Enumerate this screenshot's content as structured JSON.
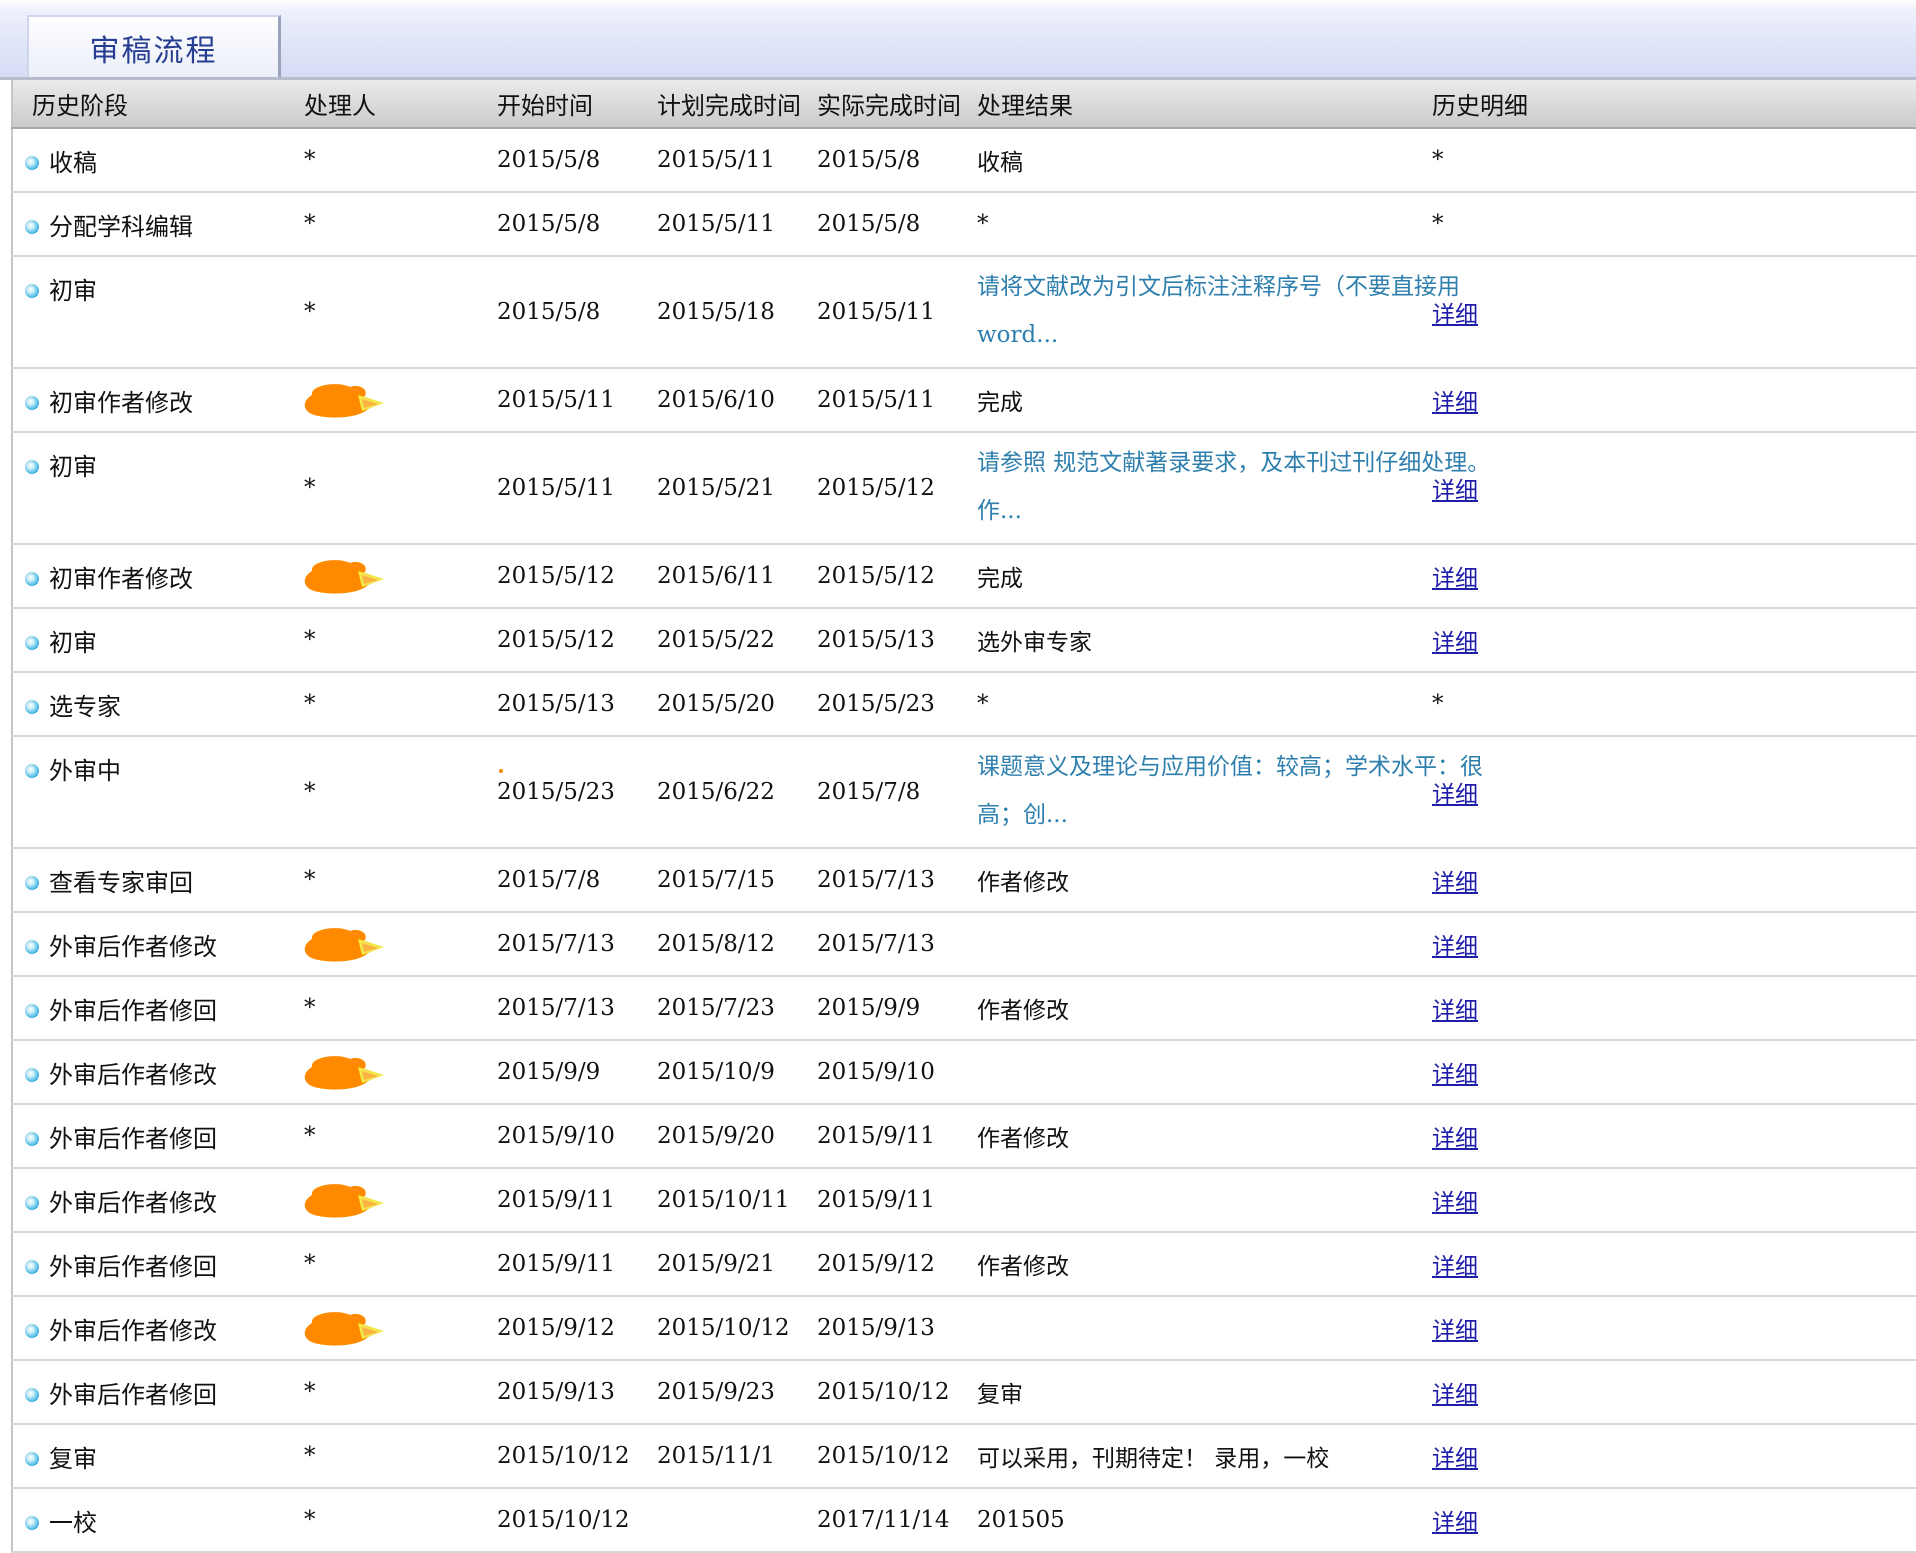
{
  "tab": {
    "title": "审稿流程"
  },
  "colors": {
    "tab_text": "#273e93",
    "link": "#1f1ea8",
    "result_note": "#2e7fae",
    "redaction": "#ff8a00"
  },
  "columns": [
    "历史阶段",
    "处理人",
    "开始时间",
    "计划完成时间",
    "实际完成时间",
    "处理结果",
    "历史明细"
  ],
  "rows": [
    {
      "stage": "收稿",
      "handler": "*",
      "start": "2015/5/8",
      "planned": "2015/5/11",
      "actual": "2015/5/8",
      "result": "收稿",
      "detail": "*"
    },
    {
      "stage": "分配学科编辑",
      "handler": "*",
      "start": "2015/5/8",
      "planned": "2015/5/11",
      "actual": "2015/5/8",
      "result": "*",
      "detail": "*"
    },
    {
      "stage": "初审",
      "handler": "*",
      "start": "2015/5/8",
      "planned": "2015/5/18",
      "actual": "2015/5/11",
      "result": "请将文献改为引文后标注注释序号（不要直接用word...",
      "detail": "详细"
    },
    {
      "stage": "初审作者修改",
      "handler": "",
      "start": "2015/5/11",
      "planned": "2015/6/10",
      "actual": "2015/5/11",
      "result": "完成",
      "detail": "详细"
    },
    {
      "stage": "初审",
      "handler": "*",
      "start": "2015/5/11",
      "planned": "2015/5/21",
      "actual": "2015/5/12",
      "result": "请参照 规范文献著录要求，及本刊过刊仔细处理。作...",
      "detail": "详细"
    },
    {
      "stage": "初审作者修改",
      "handler": "",
      "start": "2015/5/12",
      "planned": "2015/6/11",
      "actual": "2015/5/12",
      "result": "完成",
      "detail": "详细"
    },
    {
      "stage": "初审",
      "handler": "*",
      "start": "2015/5/12",
      "planned": "2015/5/22",
      "actual": "2015/5/13",
      "result": "选外审专家",
      "detail": "详细"
    },
    {
      "stage": "选专家",
      "handler": "*",
      "start": "2015/5/13",
      "planned": "2015/5/20",
      "actual": "2015/5/23",
      "result": "*",
      "detail": "*"
    },
    {
      "stage": "外审中",
      "handler": "*",
      "start": "2015/5/23",
      "planned": "2015/6/22",
      "actual": "2015/7/8",
      "result": "课题意义及理论与应用价值：较高；学术水平：很高；创...",
      "detail": "详细"
    },
    {
      "stage": "查看专家审回",
      "handler": "*",
      "start": "2015/7/8",
      "planned": "2015/7/15",
      "actual": "2015/7/13",
      "result": "作者修改",
      "detail": "详细"
    },
    {
      "stage": "外审后作者修改",
      "handler": "",
      "start": "2015/7/13",
      "planned": "2015/8/12",
      "actual": "2015/7/13",
      "result": "",
      "detail": "详细"
    },
    {
      "stage": "外审后作者修回",
      "handler": "*",
      "start": "2015/7/13",
      "planned": "2015/7/23",
      "actual": "2015/9/9",
      "result": "作者修改",
      "detail": "详细"
    },
    {
      "stage": "外审后作者修改",
      "handler": "",
      "start": "2015/9/9",
      "planned": "2015/10/9",
      "actual": "2015/9/10",
      "result": "",
      "detail": "详细"
    },
    {
      "stage": "外审后作者修回",
      "handler": "*",
      "start": "2015/9/10",
      "planned": "2015/9/20",
      "actual": "2015/9/11",
      "result": "作者修改",
      "detail": "详细"
    },
    {
      "stage": "外审后作者修改",
      "handler": "",
      "start": "2015/9/11",
      "planned": "2015/10/11",
      "actual": "2015/9/11",
      "result": "",
      "detail": "详细"
    },
    {
      "stage": "外审后作者修回",
      "handler": "*",
      "start": "2015/9/11",
      "planned": "2015/9/21",
      "actual": "2015/9/12",
      "result": "作者修改",
      "detail": "详细"
    },
    {
      "stage": "外审后作者修改",
      "handler": "",
      "start": "2015/9/12",
      "planned": "2015/10/12",
      "actual": "2015/9/13",
      "result": "",
      "detail": "详细"
    },
    {
      "stage": "外审后作者修回",
      "handler": "*",
      "start": "2015/9/13",
      "planned": "2015/9/23",
      "actual": "2015/10/12",
      "result": "复审",
      "detail": "详细"
    },
    {
      "stage": "复审",
      "handler": "*",
      "start": "2015/10/12",
      "planned": "2015/11/1",
      "actual": "2015/10/12",
      "result": "可以采用，刊期待定！ 录用，一校",
      "detail": "详细"
    },
    {
      "stage": "一校",
      "handler": "*",
      "start": "2015/10/12",
      "planned": "",
      "actual": "2017/11/14",
      "result": "201505",
      "detail": "详细"
    }
  ]
}
